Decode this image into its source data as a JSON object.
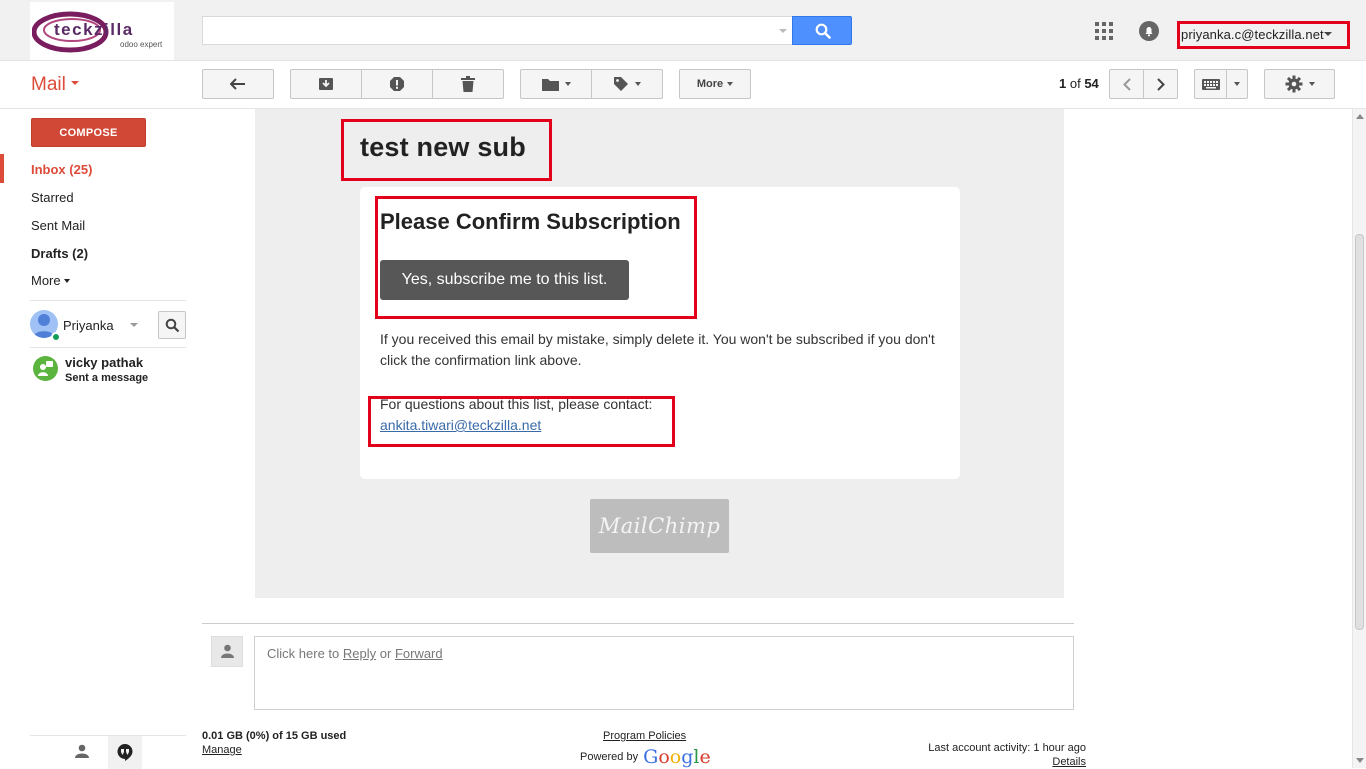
{
  "header": {
    "logo_name": "teckzilla",
    "logo_tagline": "odoo expert",
    "search_placeholder": "",
    "account_email": "priyanka.c@teckzilla.net"
  },
  "toolbar": {
    "app_label": "Mail",
    "more_label": "More",
    "pager_current": "1",
    "pager_of": "of",
    "pager_total": "54"
  },
  "sidebar": {
    "compose_label": "COMPOSE",
    "inbox_label": "Inbox (25)",
    "starred_label": "Starred",
    "sent_label": "Sent Mail",
    "drafts_label": "Drafts (2)",
    "more_label": "More",
    "hangouts_user": "Priyanka",
    "contact_name": "vicky pathak",
    "contact_status": "Sent a message"
  },
  "email": {
    "subject": "test new sub",
    "confirm_title": "Please Confirm Subscription",
    "subscribe_button": "Yes, subscribe me to this list.",
    "mistake_text": "If you received this email by mistake, simply delete it. You won't be subscribed if you don't click the confirmation link above.",
    "questions_text": "For questions about this list, please contact:",
    "contact_email": "ankita.tiwari@teckzilla.net",
    "badge_text": "MailChimp"
  },
  "reply": {
    "prefix": "Click here to",
    "reply_link": "Reply",
    "or": "or",
    "forward_link": "Forward"
  },
  "footer": {
    "storage": "0.01 GB (0%) of 15 GB used",
    "manage": "Manage",
    "policies": "Program Policies",
    "powered_by": "Powered by",
    "google": "Google",
    "activity": "Last account activity: 1 hour ago",
    "details": "Details"
  },
  "colors": {
    "accent_red": "#dd4b39",
    "highlight_box": "#e3001b",
    "search_blue": "#4d90fe",
    "logo_purple": "#7a1d5e"
  }
}
